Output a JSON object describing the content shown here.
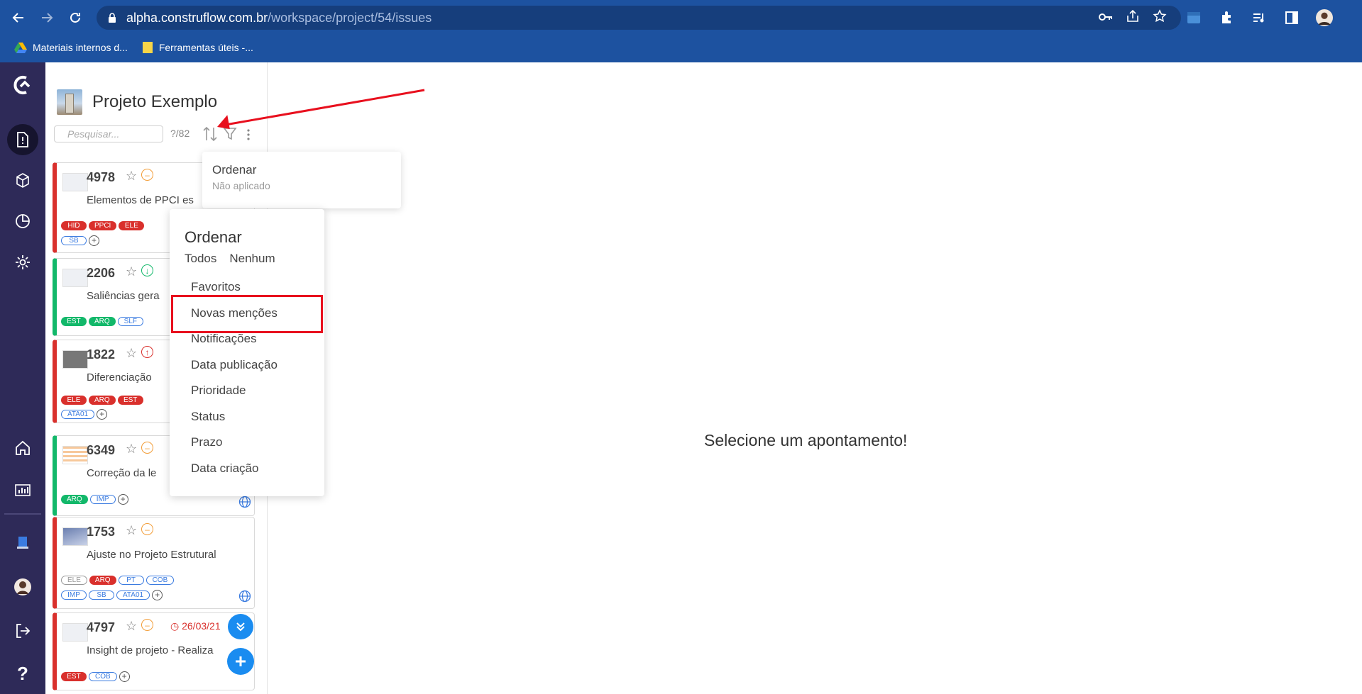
{
  "browser": {
    "url_host": "alpha.construflow.com.br",
    "url_path": "/workspace/project/54/issues",
    "bookmarks": [
      {
        "label": "Materiais internos d..."
      },
      {
        "label": "Ferramentas úteis -..."
      }
    ]
  },
  "project": {
    "name": "Projeto Exemplo",
    "search_placeholder": "Pesquisar...",
    "count": "?/82"
  },
  "issues": [
    {
      "number": "4978",
      "title": "Elementos de PPCI es",
      "tags": [
        [
          "HID",
          "red"
        ],
        [
          "PPCI",
          "red"
        ],
        [
          "ELE",
          "red"
        ],
        [
          "SB",
          "blue"
        ]
      ]
    },
    {
      "number": "2206",
      "title": "Saliências gera",
      "tags": [
        [
          "EST",
          "green"
        ],
        [
          "ARQ",
          "green"
        ],
        [
          "SLF",
          "blue"
        ]
      ]
    },
    {
      "number": "1822",
      "title": "Diferenciação",
      "tags": [
        [
          "ELE",
          "red"
        ],
        [
          "ARQ",
          "red"
        ],
        [
          "EST",
          "red"
        ],
        [
          "ATA01",
          "blue"
        ]
      ]
    },
    {
      "number": "6349",
      "title": "Correção da le",
      "tags": [
        [
          "ARQ",
          "green"
        ],
        [
          "IMP",
          "blue"
        ]
      ]
    },
    {
      "number": "1753",
      "title": "Ajuste no Projeto Estrutural",
      "tags": [
        [
          "ELE",
          "gray"
        ],
        [
          "ARQ",
          "red"
        ],
        [
          "PT",
          "blue"
        ],
        [
          "COB",
          "blue"
        ],
        [
          "IMP",
          "blue"
        ],
        [
          "SB",
          "blue"
        ],
        [
          "ATA01",
          "blue"
        ]
      ]
    },
    {
      "number": "4797",
      "title": "Insight de projeto - Realiza",
      "due": "26/03/21",
      "tags": [
        [
          "EST",
          "red"
        ],
        [
          "COB",
          "blue"
        ]
      ]
    }
  ],
  "tooltip": {
    "title": "Ordenar",
    "subtitle": "Não aplicado"
  },
  "sort_menu": {
    "title": "Ordenar",
    "all": "Todos",
    "none": "Nenhum",
    "items": [
      "Favoritos",
      "Novas menções",
      "Notificações",
      "Data publicação",
      "Prioridade",
      "Status",
      "Prazo",
      "Data criação"
    ]
  },
  "main": {
    "empty_message": "Selecione um apontamento!"
  },
  "colors": {
    "rail": "#2e2a58",
    "chrome": "#1d52a0",
    "accent": "#1a8cf0",
    "red": "#d9302c",
    "green": "#12b86a",
    "annotation": "#e8101e"
  }
}
